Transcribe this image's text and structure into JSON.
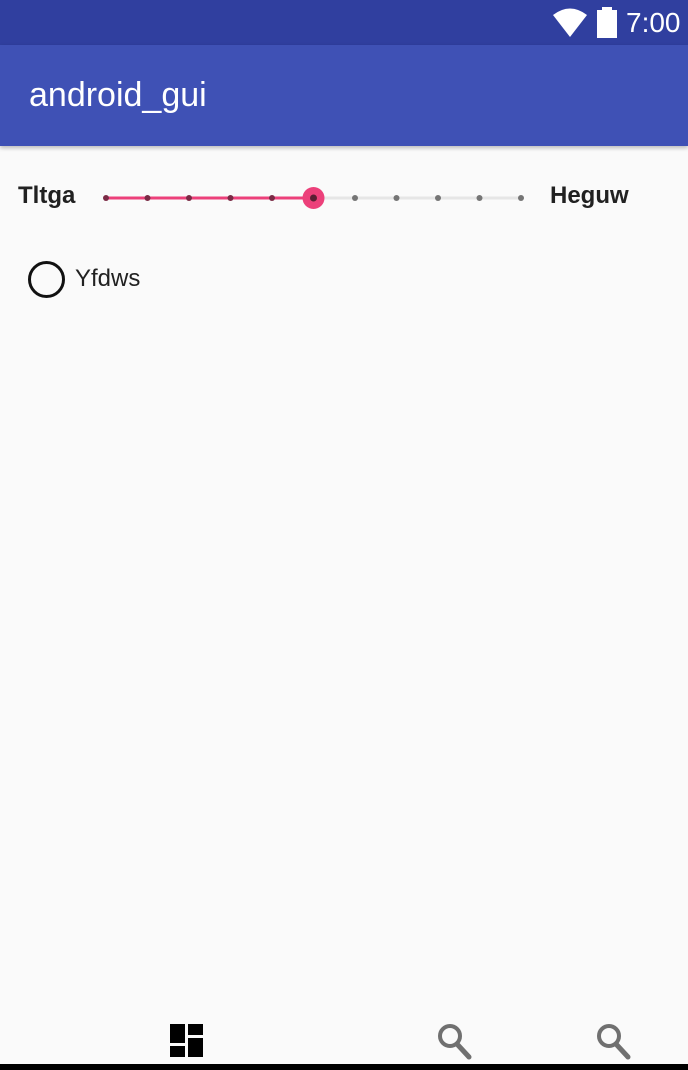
{
  "status_bar": {
    "time": "7:00",
    "icons": [
      "wifi-icon",
      "battery-icon"
    ]
  },
  "app_bar": {
    "title": "android_gui"
  },
  "slider": {
    "left_label": "Tltga",
    "right_label": "Heguw",
    "steps": 11,
    "value_step": 5,
    "accent_color": "#ec407a"
  },
  "radio": {
    "label": "Yfdws",
    "checked": false
  },
  "bottom_nav": {
    "items": [
      {
        "icon": "dashboard-icon",
        "selected": true
      },
      {
        "icon": "search-icon",
        "selected": false
      },
      {
        "icon": "search-icon",
        "selected": false
      }
    ]
  },
  "colors": {
    "primary": "#3f51b5",
    "primary_dark": "#303f9f",
    "accent": "#ec407a",
    "background": "#fafafa"
  }
}
